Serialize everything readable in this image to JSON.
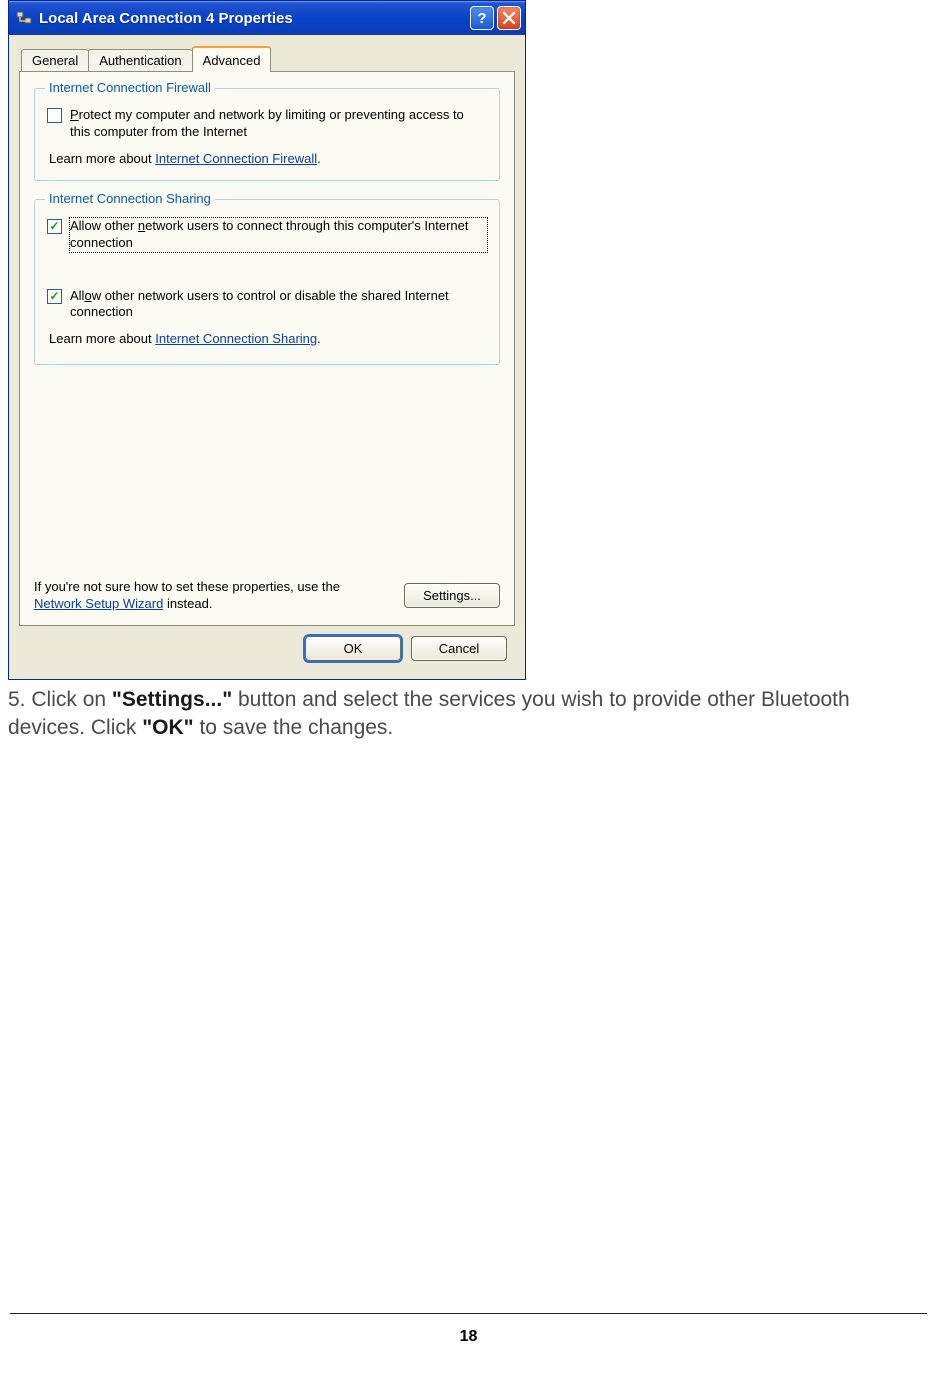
{
  "dialog": {
    "title": "Local Area Connection 4 Properties",
    "tabs": [
      "General",
      "Authentication",
      "Advanced"
    ],
    "active_tab_index": 2,
    "group_firewall": {
      "legend": "Internet Connection Firewall",
      "checkbox": {
        "checked": false,
        "label_prefix": "",
        "label_ul": "P",
        "label_rest": "rotect my computer and network by limiting or preventing access to this computer from the Internet"
      },
      "learn_prefix": "Learn more about ",
      "learn_link": "Internet Connection Firewall",
      "learn_suffix": "."
    },
    "group_sharing": {
      "legend": "Internet Connection Sharing",
      "checkbox1": {
        "checked": true,
        "focused": true,
        "label_prefix": "Allow other ",
        "label_ul": "n",
        "label_rest": "etwork users to connect through this computer's Internet connection"
      },
      "checkbox2": {
        "checked": true,
        "label_prefix": "All",
        "label_ul": "o",
        "label_rest": "w other network users to control or disable the shared Internet connection"
      },
      "learn_prefix": "Learn more about ",
      "learn_link": "Internet Connection Sharing",
      "learn_suffix": "."
    },
    "bottom_help": {
      "text_prefix": "If you're not sure how to set these properties, use the ",
      "link": "Network Setup Wizard",
      "text_suffix": " instead."
    },
    "buttons": {
      "settings": "Settings...",
      "ok": "OK",
      "cancel": "Cancel"
    }
  },
  "instruction": {
    "step_number": "5. ",
    "p1a": "Click on ",
    "bold1": "\"Settings...\"",
    "p1b": " button and select the services you wish to provide other Bluetooth devices. Click ",
    "bold2": "\"OK\"",
    "p1c": " to save the changes."
  },
  "page_number": "18"
}
